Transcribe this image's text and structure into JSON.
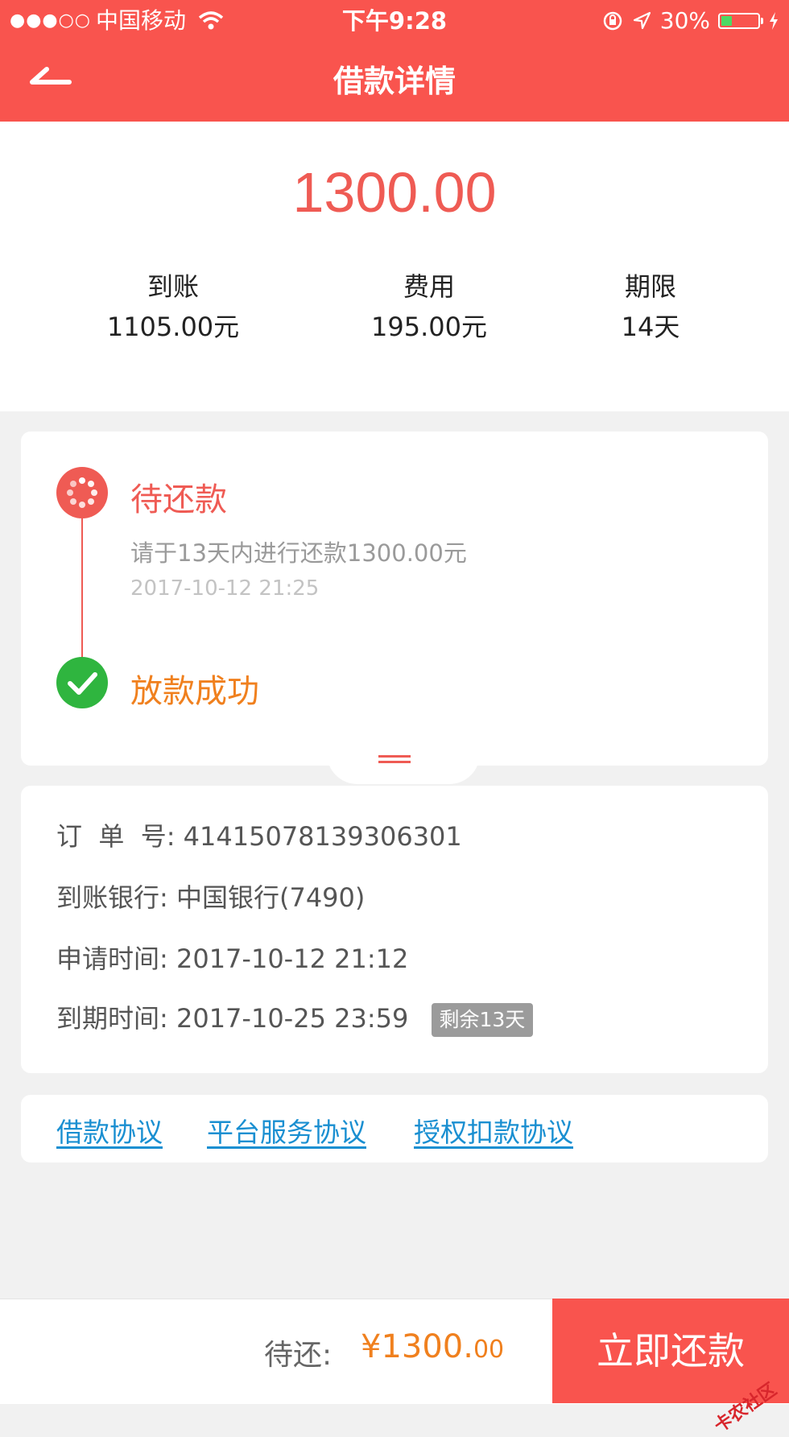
{
  "status_bar": {
    "signal_dots": "●●●○○",
    "carrier": "中国移动",
    "time": "下午9:28",
    "battery": "30%",
    "battery_level": 0.3
  },
  "nav": {
    "title": "借款详情"
  },
  "summary": {
    "amount": "1300.00",
    "stats": [
      {
        "label": "到账",
        "value": "1105.00元"
      },
      {
        "label": "费用",
        "value": "195.00元"
      },
      {
        "label": "期限",
        "value": "14天"
      }
    ]
  },
  "timeline": {
    "steps": [
      {
        "title": "待还款",
        "desc": "请于13天内进行还款1300.00元",
        "time": "2017-10-12 21:25"
      },
      {
        "title": "放款成功"
      }
    ]
  },
  "details": {
    "order": {
      "label": "订  单  号:",
      "value": "41415078139306301"
    },
    "bank": {
      "label": "到账银行:",
      "value": "中国银行(7490)"
    },
    "apply": {
      "label": "申请时间:",
      "value": "2017-10-12 21:12"
    },
    "due": {
      "label": "到期时间:",
      "value": "2017-10-25 23:59",
      "badge": "剩余13天"
    }
  },
  "links": [
    "借款协议",
    "平台服务协议",
    "授权扣款协议"
  ],
  "footer": {
    "due_label": "待还:",
    "due_amount_main": "¥1300.",
    "due_amount_cents": "00",
    "pay_button": "立即还款"
  },
  "watermark": "卡农社区",
  "colors": {
    "brand": "#f9544e",
    "amount": "#ef5b54",
    "orange": "#f0801e",
    "success": "#2fb53f",
    "link": "#1a8fd1"
  }
}
